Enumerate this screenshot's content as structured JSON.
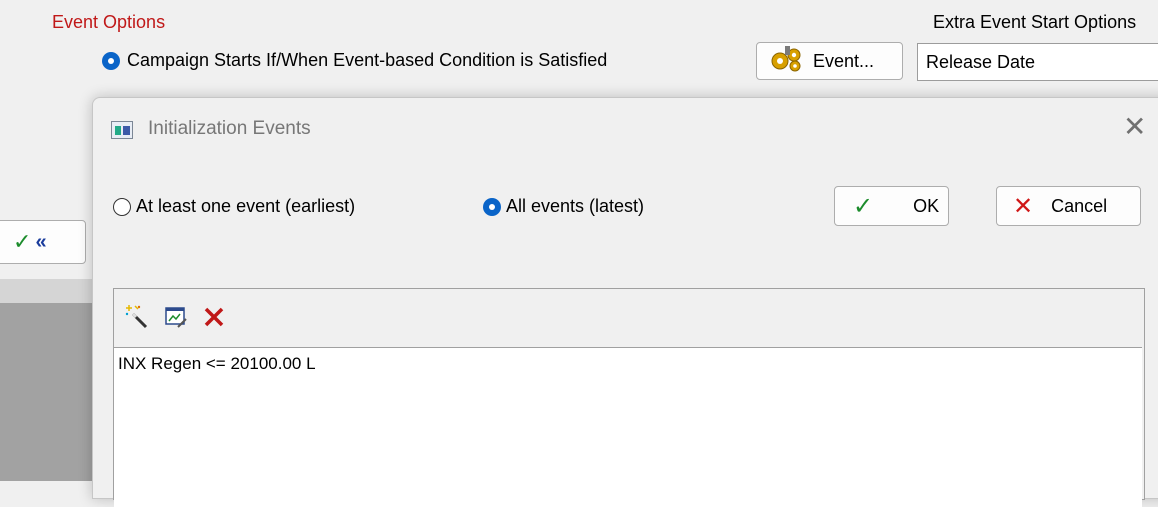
{
  "background": {
    "section_title": "Event Options",
    "campaign_option_label": "Campaign Starts If/When Event-based Condition is Satisfied",
    "event_button_label": "Event...",
    "extra_options_title": "Extra Event Start Options",
    "release_date_value": "Release Date",
    "back_button_chevron": "«"
  },
  "dialog": {
    "title": "Initialization Events",
    "close_glyph": "✕",
    "radio_at_least_one": "At least one event (earliest)",
    "radio_all_events": "All events (latest)",
    "ok_label": "OK",
    "cancel_label": "Cancel",
    "conditions": [
      "INX Regen <= 20100.00 L"
    ]
  },
  "colors": {
    "section_title": "#c01818",
    "radio_selected": "#0a64c8",
    "ok_check": "#1c8c2c",
    "cancel_x": "#d01818"
  },
  "icons": [
    "event-gears-icon",
    "app-window-icon",
    "close-icon",
    "checkmark-icon",
    "cancel-x-icon",
    "magic-wand-icon",
    "edit-condition-icon",
    "delete-condition-icon",
    "back-chevron-icon"
  ]
}
